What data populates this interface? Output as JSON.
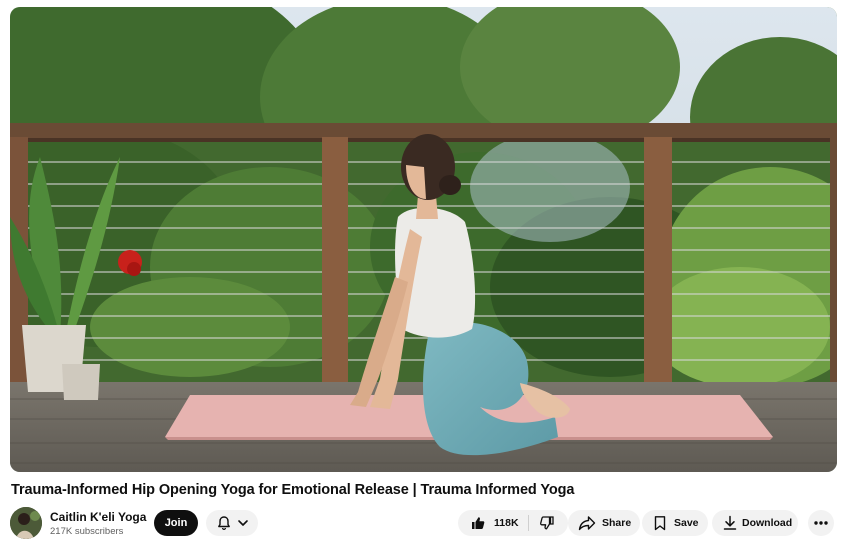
{
  "video": {
    "title": "Trauma-Informed Hip Opening Yoga for Emotional Release | Trauma Informed Yoga"
  },
  "channel": {
    "name": "Caitlin K'eli Yoga",
    "subscribers": "217K subscribers",
    "join_label": "Join"
  },
  "actions": {
    "like_count": "118K",
    "share_label": "Share",
    "save_label": "Save",
    "download_label": "Download"
  },
  "icons": {
    "notifications": "bell-icon",
    "expand": "chevron-down-icon",
    "like": "thumbs-up-icon",
    "dislike": "thumbs-down-icon",
    "share": "share-arrow-icon",
    "save": "bookmark-icon",
    "download": "download-icon",
    "more": "more-horizontal-icon"
  },
  "colors": {
    "join_button": "#0f0f0f",
    "pill_background": "#f2f2f2"
  }
}
